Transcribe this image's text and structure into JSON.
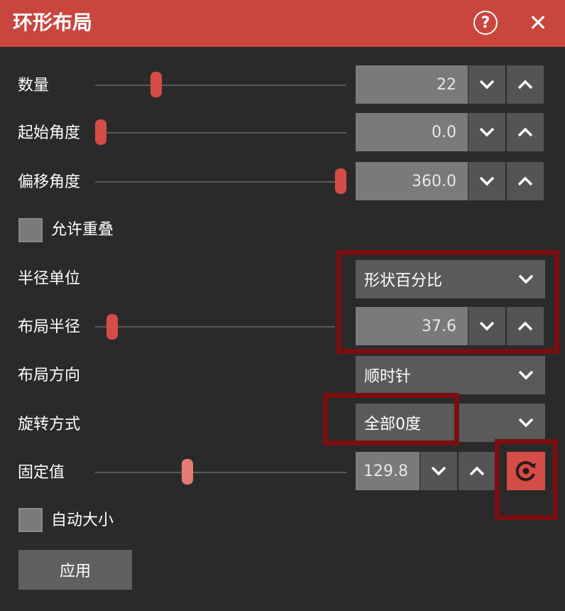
{
  "window": {
    "title": "环形布局",
    "help_symbol": "?",
    "close_symbol": "✕"
  },
  "rows": {
    "count": {
      "label": "数量",
      "value": "22",
      "slider_fraction": 0.23
    },
    "start_angle": {
      "label": "起始角度",
      "value": "0.0",
      "slider_fraction": 0.0
    },
    "offset_angle": {
      "label": "偏移角度",
      "value": "360.0",
      "slider_fraction": 1.0
    },
    "allow_overlap": {
      "label": "允许重叠",
      "checked": false
    },
    "radius_unit": {
      "label": "半径单位",
      "selected": "形状百分比"
    },
    "layout_radius": {
      "label": "布局半径",
      "value": "37.6",
      "slider_fraction": 0.05
    },
    "layout_direction": {
      "label": "布局方向",
      "selected": "顺时针"
    },
    "rotation_mode": {
      "label": "旋转方式",
      "selected": "全部0度"
    },
    "fixed_value": {
      "label": "固定值",
      "value": "129.8",
      "slider_fraction": 0.36
    },
    "auto_size": {
      "label": "自动大小",
      "checked": false
    }
  },
  "apply_label": "应用",
  "icons": {
    "spin_down": "chevron-down-icon",
    "spin_up": "chevron-up-icon",
    "dropdown": "chevron-down-icon",
    "reset": "reset-icon"
  },
  "colors": {
    "titlebar": "#c9463f",
    "accent": "#d64c46",
    "highlight": "#7a0e12",
    "panel": "#2a2a2a"
  }
}
